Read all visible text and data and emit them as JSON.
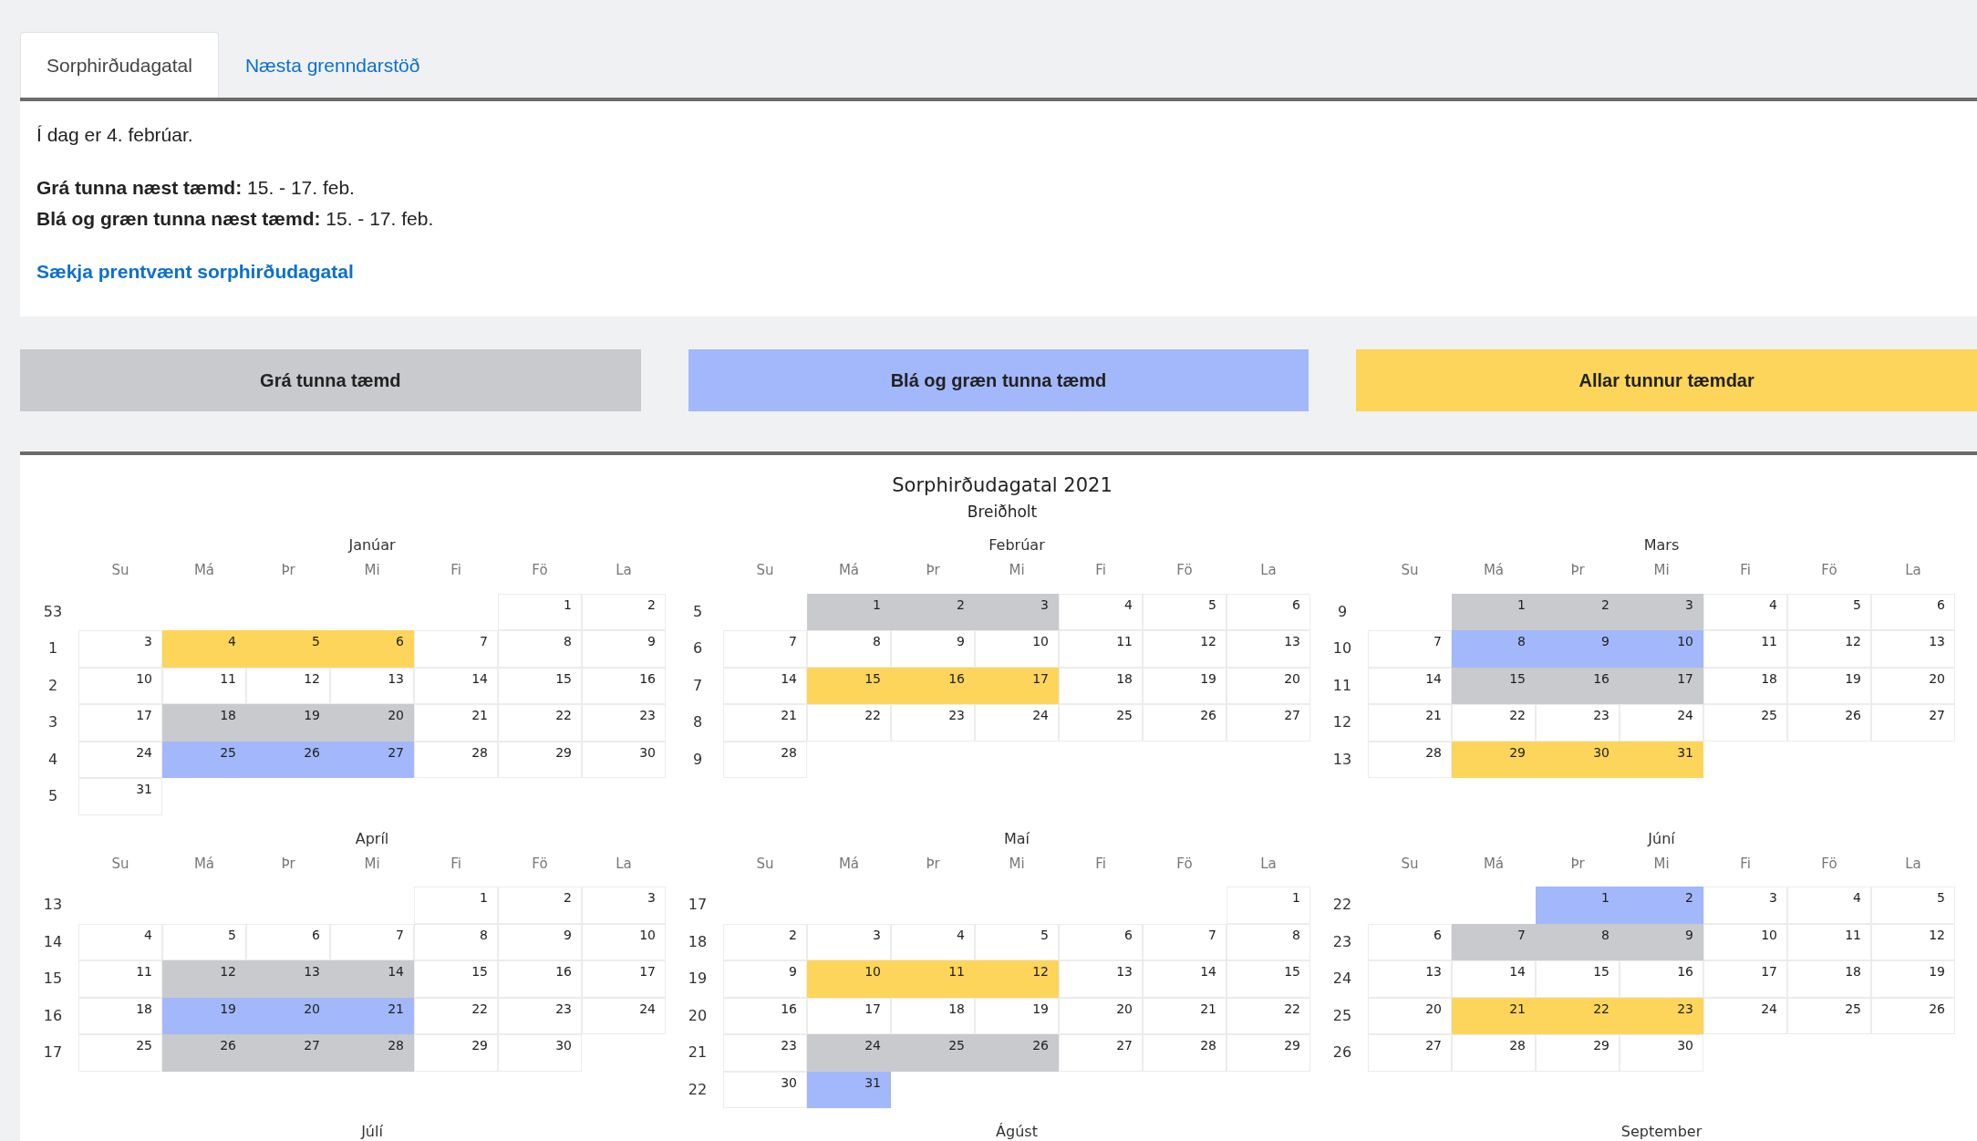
{
  "tabs": [
    {
      "label": "Sorphirðudagatal",
      "selected": true
    },
    {
      "label": "Næsta grenndarstöð",
      "selected": false
    }
  ],
  "info": {
    "today": "Í dag er 4. febrúar.",
    "next": [
      "**Grá tunna næst tæmd:** 15. - 17. feb.",
      "**Blá og græn tunna næst tæmd:** 15. - 17. feb."
    ],
    "link": "Sækja prentvænt sorphirðudagatal"
  },
  "legend": [
    {
      "label": "Grá tunna tæmd",
      "kind": "grey"
    },
    {
      "label": "Blá og græn tunna tæmd",
      "kind": "blue"
    },
    {
      "label": "Allar tunnur tæmdar",
      "kind": "all"
    }
  ],
  "calendar": {
    "title": "Sorphirðudagatal 2021",
    "subtitle": "Breiðholt",
    "months": [
      {
        "name": "Janúar",
        "weekdays": [
          "Su",
          "Má",
          "Þr",
          "Mi",
          "Fi",
          "Fö",
          "La"
        ],
        "weeks": [
          {
            "number": "53",
            "kind": "first",
            "days": [
              {
                "day": "1"
              },
              {
                "day": "2"
              }
            ]
          },
          {
            "number": "1",
            "kind": "week",
            "days": [
              {
                "day": "3"
              },
              {
                "day": "4",
                "kind": "all"
              },
              {
                "day": "5",
                "kind": "all"
              },
              {
                "day": "6",
                "kind": "all"
              },
              {
                "day": "7"
              },
              {
                "day": "8"
              },
              {
                "day": "9"
              }
            ]
          },
          {
            "number": "2",
            "kind": "week",
            "days": [
              {
                "day": "10"
              },
              {
                "day": "11"
              },
              {
                "day": "12"
              },
              {
                "day": "13"
              },
              {
                "day": "14"
              },
              {
                "day": "15"
              },
              {
                "day": "16"
              }
            ]
          },
          {
            "number": "3",
            "kind": "week",
            "days": [
              {
                "day": "17"
              },
              {
                "day": "18",
                "kind": "grey"
              },
              {
                "day": "19",
                "kind": "grey"
              },
              {
                "day": "20",
                "kind": "grey"
              },
              {
                "day": "21"
              },
              {
                "day": "22"
              },
              {
                "day": "23"
              }
            ]
          },
          {
            "number": "4",
            "kind": "week",
            "days": [
              {
                "day": "24"
              },
              {
                "day": "25",
                "kind": "blue"
              },
              {
                "day": "26",
                "kind": "blue"
              },
              {
                "day": "27",
                "kind": "blue"
              },
              {
                "day": "28"
              },
              {
                "day": "29"
              },
              {
                "day": "30"
              }
            ]
          },
          {
            "number": "5",
            "kind": "week",
            "days": [
              {
                "day": "31"
              }
            ]
          }
        ]
      },
      {
        "name": "Febrúar",
        "weekdays": [
          "Su",
          "Má",
          "Þr",
          "Mi",
          "Fi",
          "Fö",
          "La"
        ],
        "weeks": [
          {
            "number": "5",
            "kind": "first",
            "days": [
              {
                "day": "1",
                "kind": "grey"
              },
              {
                "day": "2",
                "kind": "grey"
              },
              {
                "day": "3",
                "kind": "grey"
              },
              {
                "day": "4"
              },
              {
                "day": "5"
              },
              {
                "day": "6"
              }
            ]
          },
          {
            "number": "6",
            "kind": "week",
            "days": [
              {
                "day": "7"
              },
              {
                "day": "8"
              },
              {
                "day": "9"
              },
              {
                "day": "10"
              },
              {
                "day": "11"
              },
              {
                "day": "12"
              },
              {
                "day": "13"
              }
            ]
          },
          {
            "number": "7",
            "kind": "week",
            "days": [
              {
                "day": "14"
              },
              {
                "day": "15",
                "kind": "all"
              },
              {
                "day": "16",
                "kind": "all"
              },
              {
                "day": "17",
                "kind": "all"
              },
              {
                "day": "18"
              },
              {
                "day": "19"
              },
              {
                "day": "20"
              }
            ]
          },
          {
            "number": "8",
            "kind": "week",
            "days": [
              {
                "day": "21"
              },
              {
                "day": "22"
              },
              {
                "day": "23"
              },
              {
                "day": "24"
              },
              {
                "day": "25"
              },
              {
                "day": "26"
              },
              {
                "day": "27"
              }
            ]
          },
          {
            "number": "9",
            "kind": "week",
            "days": [
              {
                "day": "28"
              }
            ]
          }
        ]
      },
      {
        "name": "Mars",
        "weekdays": [
          "Su",
          "Má",
          "Þr",
          "Mi",
          "Fi",
          "Fö",
          "La"
        ],
        "weeks": [
          {
            "number": "9",
            "kind": "first",
            "days": [
              {
                "day": "1",
                "kind": "grey"
              },
              {
                "day": "2",
                "kind": "grey"
              },
              {
                "day": "3",
                "kind": "grey"
              },
              {
                "day": "4"
              },
              {
                "day": "5"
              },
              {
                "day": "6"
              }
            ]
          },
          {
            "number": "10",
            "kind": "week",
            "days": [
              {
                "day": "7"
              },
              {
                "day": "8",
                "kind": "blue"
              },
              {
                "day": "9",
                "kind": "blue"
              },
              {
                "day": "10",
                "kind": "blue"
              },
              {
                "day": "11"
              },
              {
                "day": "12"
              },
              {
                "day": "13"
              }
            ]
          },
          {
            "number": "11",
            "kind": "week",
            "days": [
              {
                "day": "14"
              },
              {
                "day": "15",
                "kind": "grey"
              },
              {
                "day": "16",
                "kind": "grey"
              },
              {
                "day": "17",
                "kind": "grey"
              },
              {
                "day": "18"
              },
              {
                "day": "19"
              },
              {
                "day": "20"
              }
            ]
          },
          {
            "number": "12",
            "kind": "week",
            "days": [
              {
                "day": "21"
              },
              {
                "day": "22"
              },
              {
                "day": "23"
              },
              {
                "day": "24"
              },
              {
                "day": "25"
              },
              {
                "day": "26"
              },
              {
                "day": "27"
              }
            ]
          },
          {
            "number": "13",
            "kind": "week",
            "days": [
              {
                "day": "28"
              },
              {
                "day": "29",
                "kind": "all"
              },
              {
                "day": "30",
                "kind": "all"
              },
              {
                "day": "31",
                "kind": "all"
              }
            ]
          }
        ]
      },
      {
        "name": "Apríl",
        "weekdays": [
          "Su",
          "Má",
          "Þr",
          "Mi",
          "Fi",
          "Fö",
          "La"
        ],
        "weeks": [
          {
            "number": "13",
            "kind": "first",
            "days": [
              {
                "day": "1"
              },
              {
                "day": "2"
              },
              {
                "day": "3"
              }
            ]
          },
          {
            "number": "14",
            "kind": "week",
            "days": [
              {
                "day": "4"
              },
              {
                "day": "5"
              },
              {
                "day": "6"
              },
              {
                "day": "7"
              },
              {
                "day": "8"
              },
              {
                "day": "9"
              },
              {
                "day": "10"
              }
            ]
          },
          {
            "number": "15",
            "kind": "week",
            "days": [
              {
                "day": "11"
              },
              {
                "day": "12",
                "kind": "grey"
              },
              {
                "day": "13",
                "kind": "grey"
              },
              {
                "day": "14",
                "kind": "grey"
              },
              {
                "day": "15"
              },
              {
                "day": "16"
              },
              {
                "day": "17"
              }
            ]
          },
          {
            "number": "16",
            "kind": "week",
            "days": [
              {
                "day": "18"
              },
              {
                "day": "19",
                "kind": "blue"
              },
              {
                "day": "20",
                "kind": "blue"
              },
              {
                "day": "21",
                "kind": "blue"
              },
              {
                "day": "22"
              },
              {
                "day": "23"
              },
              {
                "day": "24"
              }
            ]
          },
          {
            "number": "17",
            "kind": "week",
            "days": [
              {
                "day": "25"
              },
              {
                "day": "26",
                "kind": "grey"
              },
              {
                "day": "27",
                "kind": "grey"
              },
              {
                "day": "28",
                "kind": "grey"
              },
              {
                "day": "29"
              },
              {
                "day": "30"
              }
            ]
          }
        ]
      },
      {
        "name": "Maí",
        "weekdays": [
          "Su",
          "Má",
          "Þr",
          "Mi",
          "Fi",
          "Fö",
          "La"
        ],
        "weeks": [
          {
            "number": "17",
            "kind": "first",
            "days": [
              {
                "day": "1"
              }
            ]
          },
          {
            "number": "18",
            "kind": "week",
            "days": [
              {
                "day": "2"
              },
              {
                "day": "3"
              },
              {
                "day": "4"
              },
              {
                "day": "5"
              },
              {
                "day": "6"
              },
              {
                "day": "7"
              },
              {
                "day": "8"
              }
            ]
          },
          {
            "number": "19",
            "kind": "week",
            "days": [
              {
                "day": "9"
              },
              {
                "day": "10",
                "kind": "all"
              },
              {
                "day": "11",
                "kind": "all"
              },
              {
                "day": "12",
                "kind": "all"
              },
              {
                "day": "13"
              },
              {
                "day": "14"
              },
              {
                "day": "15"
              }
            ]
          },
          {
            "number": "20",
            "kind": "week",
            "days": [
              {
                "day": "16"
              },
              {
                "day": "17"
              },
              {
                "day": "18"
              },
              {
                "day": "19"
              },
              {
                "day": "20"
              },
              {
                "day": "21"
              },
              {
                "day": "22"
              }
            ]
          },
          {
            "number": "21",
            "kind": "week",
            "days": [
              {
                "day": "23"
              },
              {
                "day": "24",
                "kind": "grey"
              },
              {
                "day": "25",
                "kind": "grey"
              },
              {
                "day": "26",
                "kind": "grey"
              },
              {
                "day": "27"
              },
              {
                "day": "28"
              },
              {
                "day": "29"
              }
            ]
          },
          {
            "number": "22",
            "kind": "week",
            "days": [
              {
                "day": "30"
              },
              {
                "day": "31",
                "kind": "blue"
              }
            ]
          }
        ]
      },
      {
        "name": "Júní",
        "weekdays": [
          "Su",
          "Má",
          "Þr",
          "Mi",
          "Fi",
          "Fö",
          "La"
        ],
        "weeks": [
          {
            "number": "22",
            "kind": "first",
            "days": [
              {
                "day": "1",
                "kind": "blue"
              },
              {
                "day": "2",
                "kind": "blue"
              },
              {
                "day": "3"
              },
              {
                "day": "4"
              },
              {
                "day": "5"
              }
            ]
          },
          {
            "number": "23",
            "kind": "week",
            "days": [
              {
                "day": "6"
              },
              {
                "day": "7",
                "kind": "grey"
              },
              {
                "day": "8",
                "kind": "grey"
              },
              {
                "day": "9",
                "kind": "grey"
              },
              {
                "day": "10"
              },
              {
                "day": "11"
              },
              {
                "day": "12"
              }
            ]
          },
          {
            "number": "24",
            "kind": "week",
            "days": [
              {
                "day": "13"
              },
              {
                "day": "14"
              },
              {
                "day": "15"
              },
              {
                "day": "16"
              },
              {
                "day": "17"
              },
              {
                "day": "18"
              },
              {
                "day": "19"
              }
            ]
          },
          {
            "number": "25",
            "kind": "week",
            "days": [
              {
                "day": "20"
              },
              {
                "day": "21",
                "kind": "all"
              },
              {
                "day": "22",
                "kind": "all"
              },
              {
                "day": "23",
                "kind": "all"
              },
              {
                "day": "24"
              },
              {
                "day": "25"
              },
              {
                "day": "26"
              }
            ]
          },
          {
            "number": "26",
            "kind": "week",
            "days": [
              {
                "day": "27"
              },
              {
                "day": "28"
              },
              {
                "day": "29"
              },
              {
                "day": "30"
              }
            ]
          }
        ]
      },
      {
        "name": "Júlí"
      },
      {
        "name": "Ágúst"
      },
      {
        "name": "September"
      }
    ]
  }
}
